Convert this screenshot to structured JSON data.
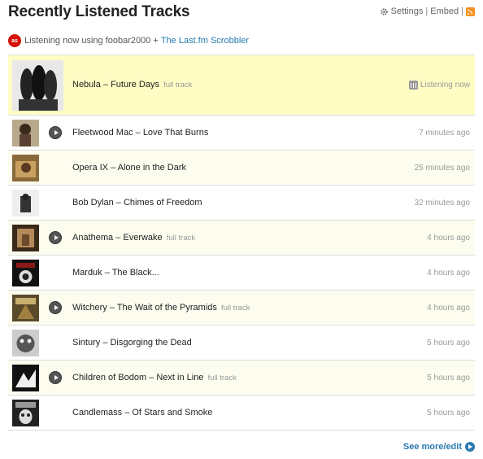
{
  "header": {
    "title": "Recently Listened Tracks",
    "settings_label": "Settings",
    "separator": "|",
    "embed_label": "Embed",
    "separator2": "|"
  },
  "scrobble": {
    "logo_text": "as",
    "text": "Listening now using foobar2000 +",
    "link_text": "The Last.fm Scrobbler"
  },
  "now_playing": {
    "artist": "Nebula",
    "track": "Future Days",
    "display": "Nebula – Future Days",
    "full_track": "full track",
    "status": "Listening now"
  },
  "tracks": [
    {
      "display": "Fleetwood Mac – Love That Burns",
      "full_track": "",
      "time": "7 minutes ago",
      "playable": true
    },
    {
      "display": "Opera IX – Alone in the Dark",
      "full_track": "",
      "time": "25 minutes ago",
      "playable": false
    },
    {
      "display": "Bob Dylan – Chimes of Freedom",
      "full_track": "",
      "time": "32 minutes ago",
      "playable": false
    },
    {
      "display": "Anathema – Everwake",
      "full_track": "full track",
      "time": "4 hours ago",
      "playable": true
    },
    {
      "display": "Marduk – The Black...",
      "full_track": "",
      "time": "4 hours ago",
      "playable": false
    },
    {
      "display": "Witchery – The Wait of the Pyramids",
      "full_track": "full track",
      "time": "4 hours ago",
      "playable": true
    },
    {
      "display": "Sintury – Disgorging the Dead",
      "full_track": "",
      "time": "5 hours ago",
      "playable": false
    },
    {
      "display": "Children of Bodom – Next in Line",
      "full_track": "full track",
      "time": "5 hours ago",
      "playable": true
    },
    {
      "display": "Candlemass – Of Stars and Smoke",
      "full_track": "",
      "time": "5 hours ago",
      "playable": false
    }
  ],
  "footer": {
    "see_more": "See more/edit"
  },
  "colors": {
    "accent_link": "#2a7ab0",
    "now_playing_bg": "#fffcc4",
    "alt_row_bg": "#fdfdef",
    "lastfm_red": "#d51007"
  }
}
